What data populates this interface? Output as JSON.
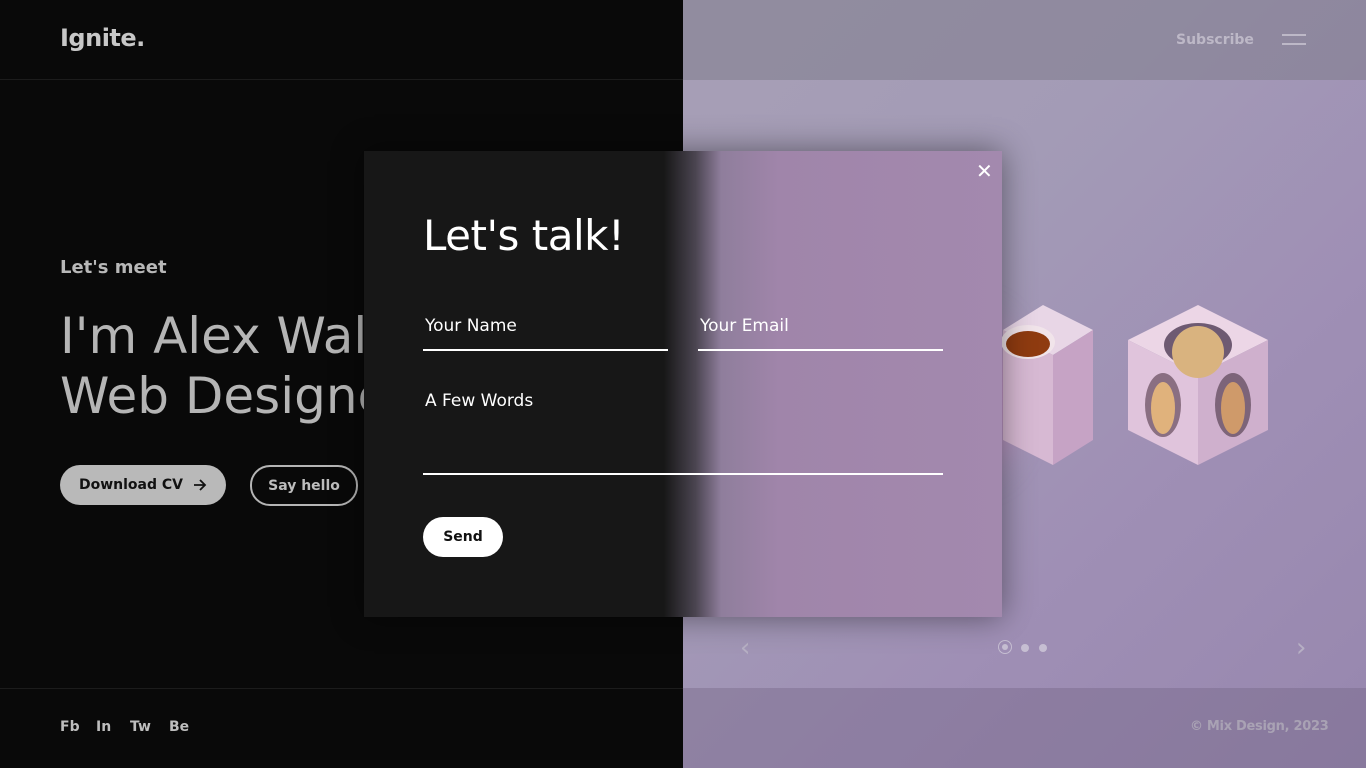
{
  "header": {
    "logo": "Ignite.",
    "subscribe_label": "Subscribe"
  },
  "hero": {
    "eyebrow": "Let's meet",
    "line1": "I'm Alex Wall",
    "line2": "Web Designe",
    "download_label": "Download CV",
    "hello_label": "Say hello"
  },
  "footer": {
    "social": [
      "Fb",
      "In",
      "Tw",
      "Be"
    ],
    "copyright": "© Mix Design, 2023"
  },
  "slider": {
    "active_index": 0,
    "count": 3
  },
  "modal": {
    "title": "Let's talk!",
    "name_placeholder": "Your Name",
    "email_placeholder": "Your Email",
    "words_placeholder": "A Few Words",
    "send_label": "Send"
  }
}
